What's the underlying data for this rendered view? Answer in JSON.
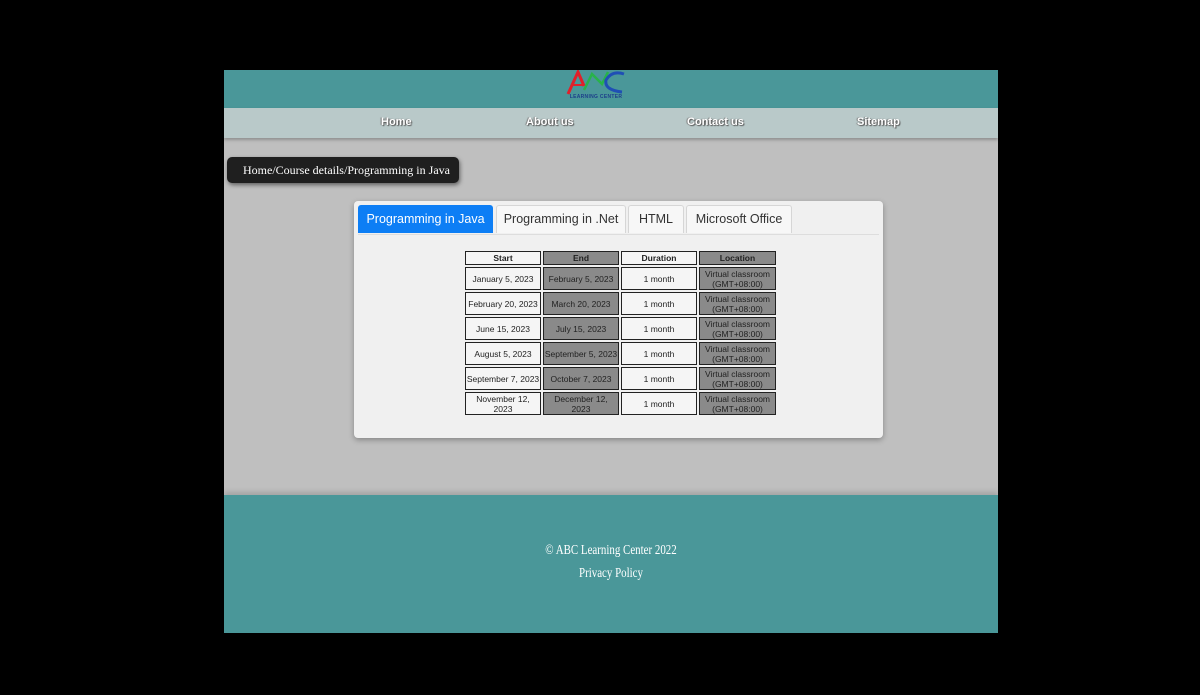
{
  "header": {
    "logo_text": "ABC",
    "logo_subtitle": "LEARNING CENTER",
    "colors": {
      "header_bg": "#4a9799",
      "nav_bg": "#b9c9c9"
    }
  },
  "nav": {
    "items": [
      "Home",
      "About us",
      "Contact us",
      "Sitemap"
    ]
  },
  "breadcrumb": "Home/Course details/Programming in Java",
  "tabs": {
    "items": [
      "Programming in Java",
      "Programming in .Net",
      "HTML",
      "Microsoft Office"
    ],
    "active": "Programming in Java",
    "active_color": "#0d7ef5"
  },
  "table": {
    "headers": [
      "Start",
      "End",
      "Duration",
      "Location"
    ],
    "rows": [
      [
        "January 5, 2023",
        "February 5, 2023",
        "1 month",
        "Virtual classroom (GMT+08:00)"
      ],
      [
        "February 20, 2023",
        "March 20, 2023",
        "1 month",
        "Virtual classroom (GMT+08:00)"
      ],
      [
        "June 15, 2023",
        "July 15, 2023",
        "1 month",
        "Virtual classroom (GMT+08:00)"
      ],
      [
        "August 5, 2023",
        "September 5, 2023",
        "1 month",
        "Virtual classroom (GMT+08:00)"
      ],
      [
        "September 7, 2023",
        "October 7, 2023",
        "1 month",
        "Virtual classroom (GMT+08:00)"
      ],
      [
        "November 12, 2023",
        "December 12, 2023",
        "1 month",
        "Virtual classroom (GMT+08:00)"
      ]
    ]
  },
  "footer": {
    "copyright": "© ABC Learning Center 2022",
    "privacy": "Privacy Policy"
  }
}
